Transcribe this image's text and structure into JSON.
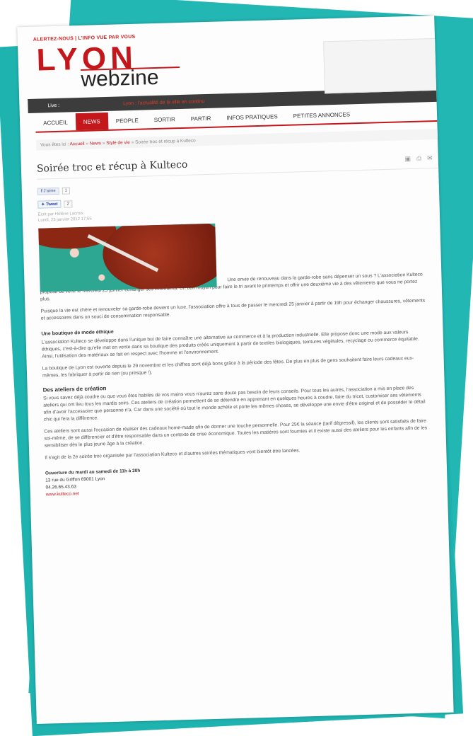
{
  "header": {
    "alert_line": "ALERTEZ-NOUS | L'INFO VUE PAR VOUS",
    "logo_top": "LYON",
    "logo_bottom": "webzine",
    "live_label": "Live :",
    "live_ticker": "Lyon : l'actualité de la ville en continu",
    "arrows": "◂ ▸"
  },
  "nav": {
    "tabs": [
      "ACCUEIL",
      "NEWS",
      "PEOPLE",
      "SORTIR",
      "PARTIR",
      "INFOS PRATIQUES",
      "PETITES ANNONCES"
    ]
  },
  "breadcrumb": {
    "prefix": "Vous êtes ici :",
    "items": [
      "Accueil",
      "News",
      "Style de vie"
    ],
    "current": "Soirée troc et récup à Kulteco"
  },
  "article": {
    "title": "Soirée troc et récup à Kulteco",
    "like_label": "J'aime",
    "like_count": "1",
    "tweet_label": "Tweet",
    "tweet_count": "2",
    "author": "Écrit par Hélène Lacroix",
    "date": "Lundi, 23 janvier 2012 17:55",
    "p1": "Une envie de renouveau dans la garde-robe sans dépenser un sous ? L'association Kulteco propose de venir le mercredi 25 janvier échanger ses vêtements. Un bon moyen pour faire le tri avant le printemps et offrir une deuxième vie à des vêtements que vous ne portez plus.",
    "p2": "Puisque la vie est chère et renouveler sa garde-robe devient un luxe, l'association offre à tous de passer le mercredi 25 janvier à partir de 19h pour échanger chaussures, vêtements et accessoires dans un souci de consommation responsable.",
    "h1": "Une boutique de mode éthique",
    "p3": "L'association Kulteco se développe dans l'unique but de faire connaître une alternative au commerce et à la production industrielle. Elle propose donc une mode aux valeurs éthiques, c'est-à-dire qu'elle met en vente dans sa boutique des produits créés uniquement à partir de textiles biologiques, teintures végétales, recyclage ou commerce équitable. Ainsi, l'utilisation des matériaux se fait en respect avec l'homme et l'environnement.",
    "p4": "La boutique de Lyon est ouverte depuis le 29 novembre et les chiffres sont déjà bons grâce à la période des fêtes. De plus en plus de gens souhaitent faire leurs cadeaux eux-mêmes, les fabriquer à partir de rien (ou presque !).",
    "h2": "Des ateliers de création",
    "p5": "Si vous savez déjà coudre ou que vous êtes habiles de vos mains vous n'aurez sans doute pas besoin de leurs conseils. Pour tous les autres, l'association a mis en place des ateliers qui ont lieu tous les mardis soirs. Ces ateliers de création permettent de se détendre en apprenant en quelques heures à coudre, faire du tricot, customiser ses vêtements afin d'avoir l'accessoire que personne n'a. Car dans une société où tout le monde achète et porte les mêmes choses, se développe une envie d'être original et de posséder le détail chic qui fera la différence.",
    "p6": "Ces ateliers sont aussi l'occasion de réaliser des cadeaux home-made afin de donner une touche personnelle. Pour 25€ la séance (tarif dégressif), les clients sont satisfaits de faire soi-même, de se différencier et d'être responsable dans un contexte de crise économique. Toutes les matières sont fournies et il existe aussi des ateliers pour les enfants afin de les sensibiliser dès le plus jeune âge à la création.",
    "p7": "Il s'agit de la 2e soirée troc organisée par l'association Kulteco et d'autres soirées thématiques vont bientôt être lancées.",
    "hours_title": "Ouverture du mardi au samedi de 11h à 20h",
    "address": "13 rue du Griffon 69001 Lyon",
    "phone": "04.26.65.43.63",
    "website": "www.kulteco.net"
  },
  "icons": {
    "tools": [
      "pdf-icon",
      "print-icon",
      "email-icon"
    ]
  },
  "colors": {
    "brand_red": "#c4171c",
    "frame_teal": "#1fb3b0",
    "live_bar": "#3c3c3c"
  }
}
